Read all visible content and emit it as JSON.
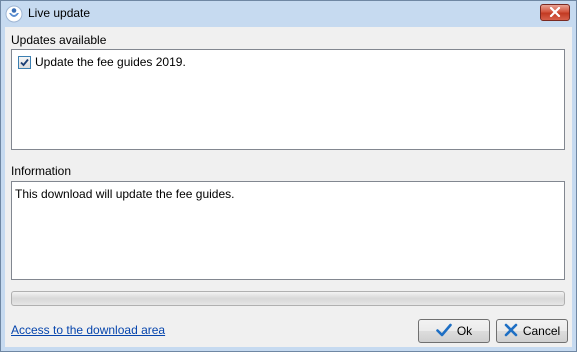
{
  "window": {
    "title": "Live update"
  },
  "updates": {
    "label": "Updates available",
    "items": [
      {
        "label": "Update the fee guides 2019.",
        "checked": true
      }
    ]
  },
  "information": {
    "label": "Information",
    "text": "This download will update the fee guides."
  },
  "progress": {
    "value": 0
  },
  "links": {
    "download_area": "Access to the download area"
  },
  "buttons": {
    "ok": "Ok",
    "cancel": "Cancel"
  },
  "colors": {
    "ok_check": "#1e6fc4",
    "cancel_x": "#1e6fc4",
    "close_button": "#c94a33"
  },
  "icons": {
    "app": "app-person-icon",
    "close": "close-icon",
    "ok": "checkmark-icon",
    "cancel": "x-icon"
  }
}
